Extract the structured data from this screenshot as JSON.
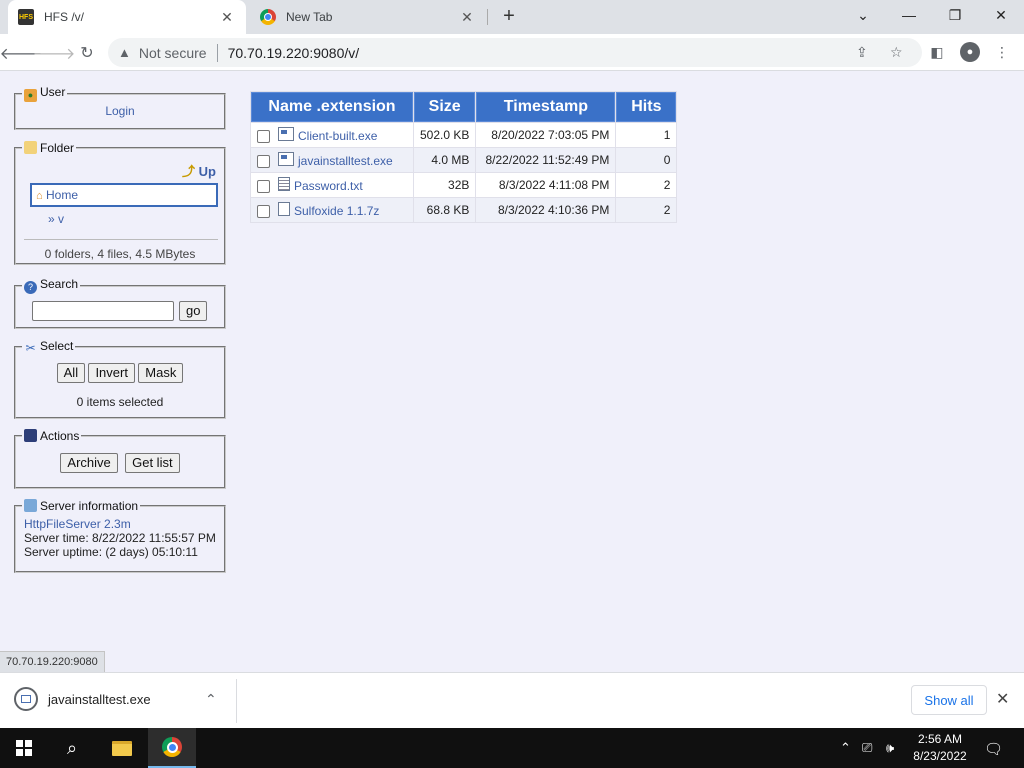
{
  "browser": {
    "tabs": [
      {
        "title": "HFS /v/",
        "favicon": "hfs-favicon",
        "active": true
      },
      {
        "title": "New Tab",
        "favicon": "chrome-favicon",
        "active": false
      }
    ],
    "security_label": "Not secure",
    "url": "70.70.19.220:9080/v/",
    "status_url": "70.70.19.220:9080"
  },
  "sidebar": {
    "user": {
      "legend": "User",
      "login_label": "Login"
    },
    "folder": {
      "legend": "Folder",
      "up_label": "Up",
      "home_label": "Home",
      "sub_label": "» v",
      "summary": "0 folders, 4 files, 4.5 MBytes"
    },
    "search": {
      "legend": "Search",
      "value": "",
      "go_label": "go"
    },
    "select": {
      "legend": "Select",
      "all_label": "All",
      "invert_label": "Invert",
      "mask_label": "Mask",
      "count_text": "0 items selected"
    },
    "actions": {
      "legend": "Actions",
      "archive_label": "Archive",
      "getlist_label": "Get list"
    },
    "server": {
      "legend": "Server information",
      "software": "HttpFileServer 2.3m",
      "time": "Server time: 8/22/2022 11:55:57 PM",
      "uptime": "Server uptime: (2 days) 05:10:11"
    }
  },
  "files": {
    "headers": {
      "name": "Name .extension",
      "size": "Size",
      "timestamp": "Timestamp",
      "hits": "Hits"
    },
    "rows": [
      {
        "name": "Client-built.exe",
        "size": "502.0 KB",
        "timestamp": "8/20/2022 7:03:05 PM",
        "hits": "1",
        "icon": "exe"
      },
      {
        "name": "javainstalltest.exe",
        "size": "4.0 MB",
        "timestamp": "8/22/2022 11:52:49 PM",
        "hits": "0",
        "icon": "exe"
      },
      {
        "name": "Password.txt",
        "size": "32B",
        "timestamp": "8/3/2022 4:11:08 PM",
        "hits": "2",
        "icon": "txt"
      },
      {
        "name": "Sulfoxide 1.1.7z",
        "size": "68.8 KB",
        "timestamp": "8/3/2022 4:10:36 PM",
        "hits": "2",
        "icon": "gen"
      }
    ]
  },
  "downloads": {
    "filename": "javainstalltest.exe",
    "show_all_label": "Show all"
  },
  "taskbar": {
    "time": "2:56 AM",
    "date": "8/23/2022"
  },
  "colors": {
    "table_header": "#3a71c8",
    "page_bg": "#f0f0fa",
    "link": "#3d5fa8",
    "accent": "#1a73e8"
  }
}
